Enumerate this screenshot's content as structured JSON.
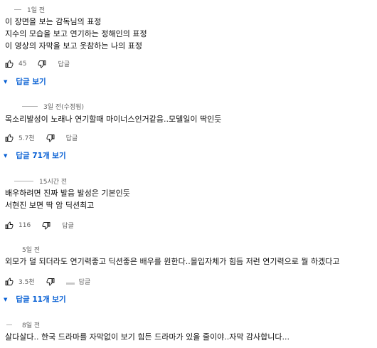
{
  "comments": [
    {
      "time": "1일 전",
      "lines": [
        "이 장면을 보는 감독님의 표정",
        "지수의 모습을 보고 연기하는 정해인의 표정",
        "이 영상의 자막을 보고 웃참하는 나의 표정"
      ],
      "likes": "45",
      "reply_label": "답글",
      "replies_label": "답글 보기"
    },
    {
      "time": "3일 전(수정됨)",
      "lines": [
        "목소리발성이 노래나 연기할때 마이너스인거같음..모델일이 딱인듯"
      ],
      "likes": "5.7천",
      "reply_label": "답글",
      "replies_prefix": "답글 ",
      "replies_count": "71개",
      "replies_suffix": " 보기"
    },
    {
      "time": "15시간 전",
      "lines": [
        "배우하려면 진짜 발음 발성은 기본인듯",
        "서현진 보면 딱 암 딕션최고"
      ],
      "likes": "116",
      "reply_label": "답글"
    },
    {
      "time": "5일 전",
      "lines": [
        "외모가 덜 되더라도 연기력좋고 딕션좋은 배우를 원한다..몰입자체가 힘듬 저런 연기력으로 뭘 하겠다고"
      ],
      "likes": "3.5천",
      "reply_label": "답글",
      "replies_prefix": "답글 ",
      "replies_count": "11개",
      "replies_suffix": " 보기"
    },
    {
      "time": "8일 전",
      "lines": [
        "살다살다.. 한국 드라마를 자막없이 보기 힘든 드라마가 있을 줄이야..자막 감사합니다..."
      ]
    }
  ],
  "colors": {
    "link": "#065fd4",
    "meta": "#606060",
    "text": "#0f0f0f"
  },
  "icons": {
    "like": "thumbs-up-icon",
    "dislike": "thumbs-down-icon",
    "expand": "triangle-down-icon"
  }
}
